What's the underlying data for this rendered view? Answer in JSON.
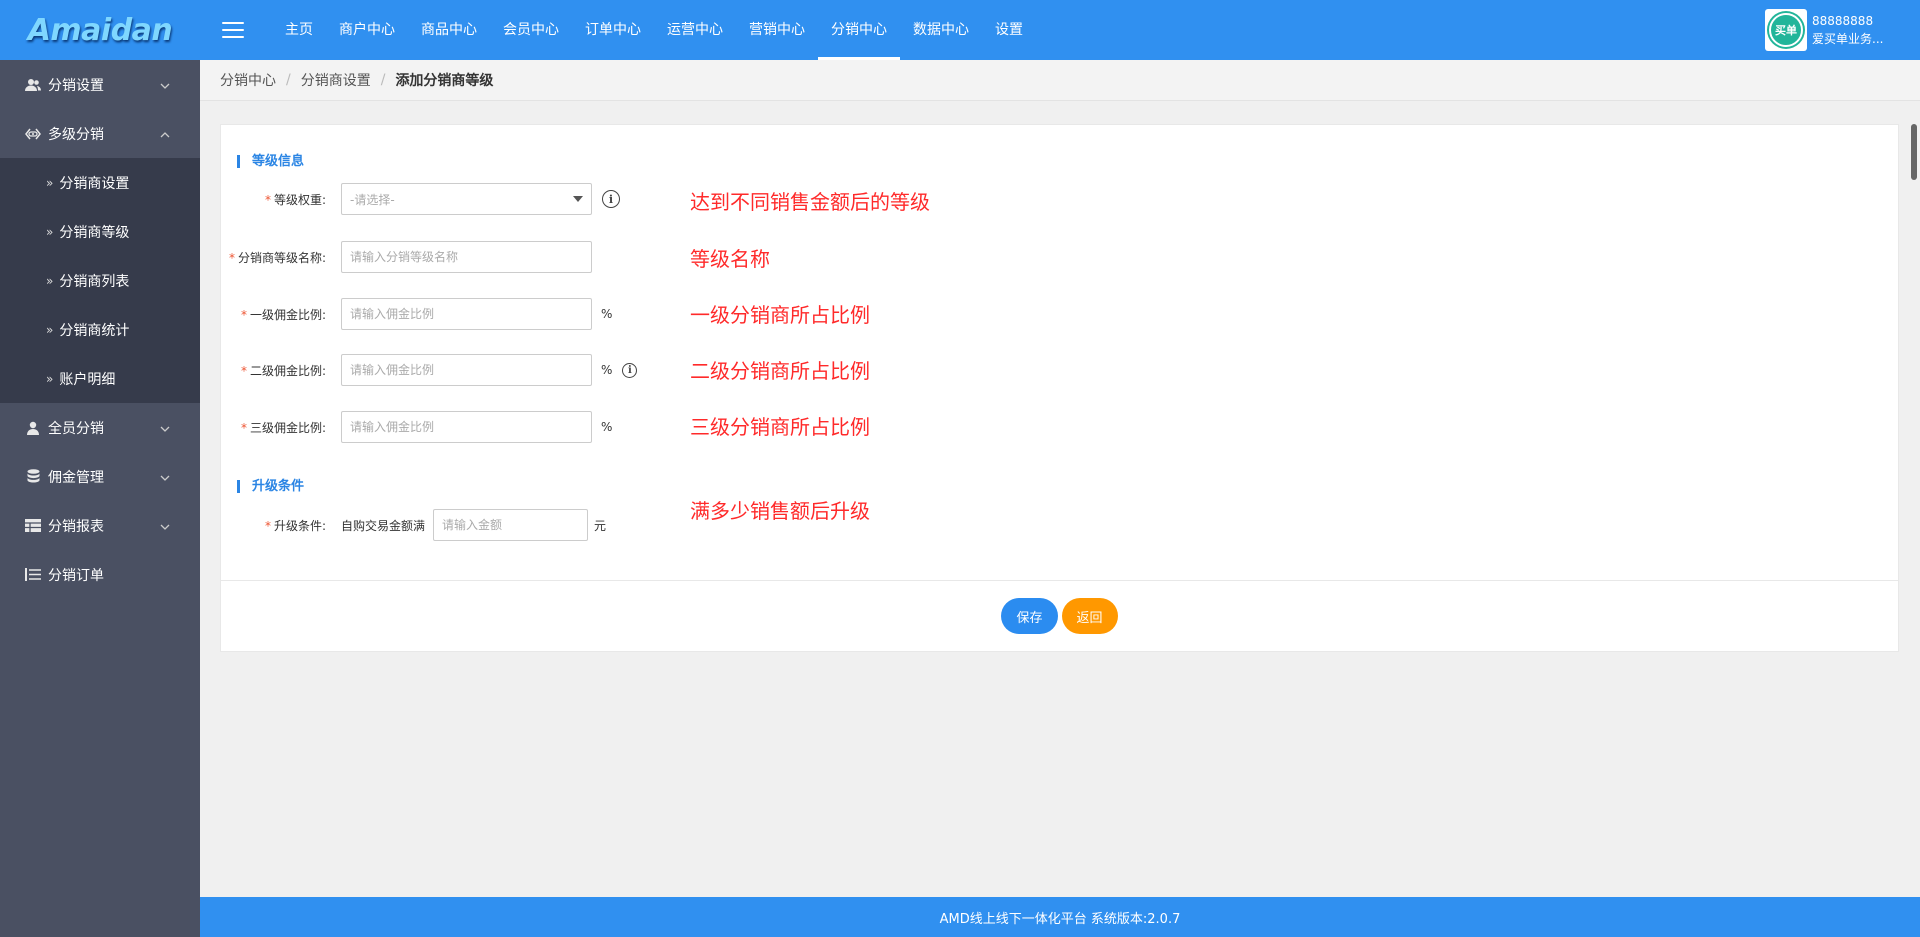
{
  "logo": "Amaidan",
  "nav": [
    "主页",
    "商户中心",
    "商品中心",
    "会员中心",
    "订单中心",
    "运营中心",
    "营销中心",
    "分销中心",
    "数据中心",
    "设置"
  ],
  "nav_active_index": 7,
  "user": {
    "avatar_text": "买单",
    "id": "88888888",
    "name": "爱买单业务..."
  },
  "sidebar": {
    "items": [
      {
        "label": "分销设置",
        "icon": "users-icon",
        "expanded": false
      },
      {
        "label": "多级分销",
        "icon": "link-icon",
        "expanded": true,
        "children": [
          "分销商设置",
          "分销商等级",
          "分销商列表",
          "分销商统计",
          "账户明细"
        ]
      },
      {
        "label": "全员分销",
        "icon": "user-icon",
        "expanded": false
      },
      {
        "label": "佣金管理",
        "icon": "database-icon",
        "expanded": false
      },
      {
        "label": "分销报表",
        "icon": "table-icon",
        "expanded": false
      },
      {
        "label": "分销订单",
        "icon": "list-icon",
        "expanded": false
      }
    ]
  },
  "breadcrumb": [
    "分销中心",
    "分销商设置",
    "添加分销商等级"
  ],
  "form": {
    "section1": "等级信息",
    "section2": "升级条件",
    "level_weight": {
      "label": "等级权重:",
      "placeholder": "-请选择-"
    },
    "level_name": {
      "label": "分销商等级名称:",
      "placeholder": "请输入分销等级名称"
    },
    "commission1": {
      "label": "一级佣金比例:",
      "placeholder": "请输入佣金比例",
      "unit": "%"
    },
    "commission2": {
      "label": "二级佣金比例:",
      "placeholder": "请输入佣金比例",
      "unit": "%"
    },
    "commission3": {
      "label": "三级佣金比例:",
      "placeholder": "请输入佣金比例",
      "unit": "%"
    },
    "upgrade": {
      "label": "升级条件:",
      "prefix": "自购交易金额满",
      "placeholder": "请输入金额",
      "unit": "元"
    }
  },
  "annotations": [
    "达到不同销售金额后的等级",
    "等级名称",
    "一级分销商所占比例",
    "二级分销商所占比例",
    "三级分销商所占比例",
    "满多少销售额后升级"
  ],
  "buttons": {
    "save": "保存",
    "back": "返回"
  },
  "footer": "AMD线上线下一体化平台 系统版本:2.0.7",
  "colors": {
    "primary": "#3090f0",
    "sidebar": "#4a5062",
    "submenu": "#363b4b",
    "annotation": "#ff2a2a",
    "back_button": "#ff9800"
  }
}
